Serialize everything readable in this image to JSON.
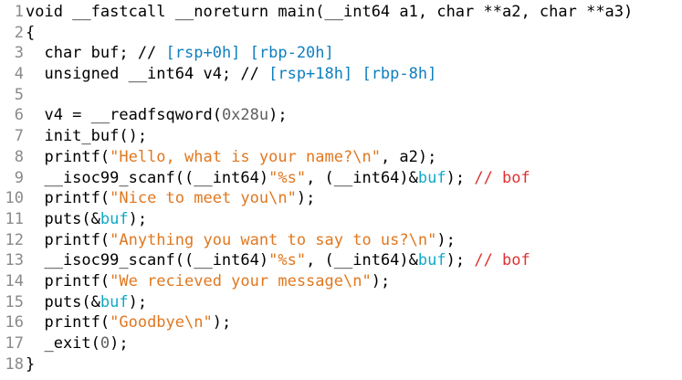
{
  "editor": {
    "lines": [
      {
        "num": "1",
        "tokens": [
          {
            "t": "void __fastcall __noreturn main(__int64 a1, char **a2, char **a3)",
            "k": "n"
          }
        ]
      },
      {
        "num": "2",
        "tokens": [
          {
            "t": "{",
            "k": "n"
          }
        ]
      },
      {
        "num": "3",
        "tokens": [
          {
            "t": "  char buf; // ",
            "k": "n"
          },
          {
            "t": "[rsp+0h] [rbp-20h]",
            "k": "c"
          }
        ]
      },
      {
        "num": "4",
        "tokens": [
          {
            "t": "  unsigned __int64 v4; // ",
            "k": "n"
          },
          {
            "t": "[rsp+18h] [rbp-8h]",
            "k": "c"
          }
        ]
      },
      {
        "num": "5",
        "tokens": []
      },
      {
        "num": "6",
        "tokens": [
          {
            "t": "  v4 = __readfsqword(",
            "k": "n"
          },
          {
            "t": "0x28u",
            "k": "m"
          },
          {
            "t": ");",
            "k": "n"
          }
        ]
      },
      {
        "num": "7",
        "tokens": [
          {
            "t": "  init_buf();",
            "k": "n"
          }
        ]
      },
      {
        "num": "8",
        "tokens": [
          {
            "t": "  printf(",
            "k": "n"
          },
          {
            "t": "\"Hello, what is your name?\\n\"",
            "k": "s"
          },
          {
            "t": ", a2);",
            "k": "n"
          }
        ]
      },
      {
        "num": "9",
        "tokens": [
          {
            "t": "  __isoc99_scanf((__int64)",
            "k": "n"
          },
          {
            "t": "\"%s\"",
            "k": "s"
          },
          {
            "t": ", (__int64)&",
            "k": "n"
          },
          {
            "t": "buf",
            "k": "v"
          },
          {
            "t": "); ",
            "k": "n"
          },
          {
            "t": "// bof",
            "k": "r"
          }
        ]
      },
      {
        "num": "10",
        "tokens": [
          {
            "t": "  printf(",
            "k": "n"
          },
          {
            "t": "\"Nice to meet you\\n\"",
            "k": "s"
          },
          {
            "t": ");",
            "k": "n"
          }
        ]
      },
      {
        "num": "11",
        "tokens": [
          {
            "t": "  puts(&",
            "k": "n"
          },
          {
            "t": "buf",
            "k": "v"
          },
          {
            "t": ");",
            "k": "n"
          }
        ]
      },
      {
        "num": "12",
        "tokens": [
          {
            "t": "  printf(",
            "k": "n"
          },
          {
            "t": "\"Anything you want to say to us?\\n\"",
            "k": "s"
          },
          {
            "t": ");",
            "k": "n"
          }
        ]
      },
      {
        "num": "13",
        "tokens": [
          {
            "t": "  __isoc99_scanf((__int64)",
            "k": "n"
          },
          {
            "t": "\"%s\"",
            "k": "s"
          },
          {
            "t": ", (__int64)&",
            "k": "n"
          },
          {
            "t": "buf",
            "k": "v"
          },
          {
            "t": "); ",
            "k": "n"
          },
          {
            "t": "// bof",
            "k": "r"
          }
        ]
      },
      {
        "num": "14",
        "tokens": [
          {
            "t": "  printf(",
            "k": "n"
          },
          {
            "t": "\"We recieved your message\\n\"",
            "k": "s"
          },
          {
            "t": ");",
            "k": "n"
          }
        ]
      },
      {
        "num": "15",
        "tokens": [
          {
            "t": "  puts(&",
            "k": "n"
          },
          {
            "t": "buf",
            "k": "v"
          },
          {
            "t": ");",
            "k": "n"
          }
        ]
      },
      {
        "num": "16",
        "tokens": [
          {
            "t": "  printf(",
            "k": "n"
          },
          {
            "t": "\"Goodbye\\n\"",
            "k": "s"
          },
          {
            "t": ");",
            "k": "n"
          }
        ]
      },
      {
        "num": "17",
        "tokens": [
          {
            "t": "  _exit(",
            "k": "n"
          },
          {
            "t": "0",
            "k": "m"
          },
          {
            "t": ");",
            "k": "n"
          }
        ]
      },
      {
        "num": "18",
        "tokens": [
          {
            "t": "}",
            "k": "n"
          }
        ]
      }
    ],
    "colors": {
      "background": "#ffffff",
      "line_number": "#8a8a8a",
      "code": "#000000",
      "string": "#e07820",
      "comment_annotation": "#0f7fbf",
      "variable": "#10a8c8",
      "comment_bof": "#e03030",
      "numeric": "#606060"
    }
  }
}
